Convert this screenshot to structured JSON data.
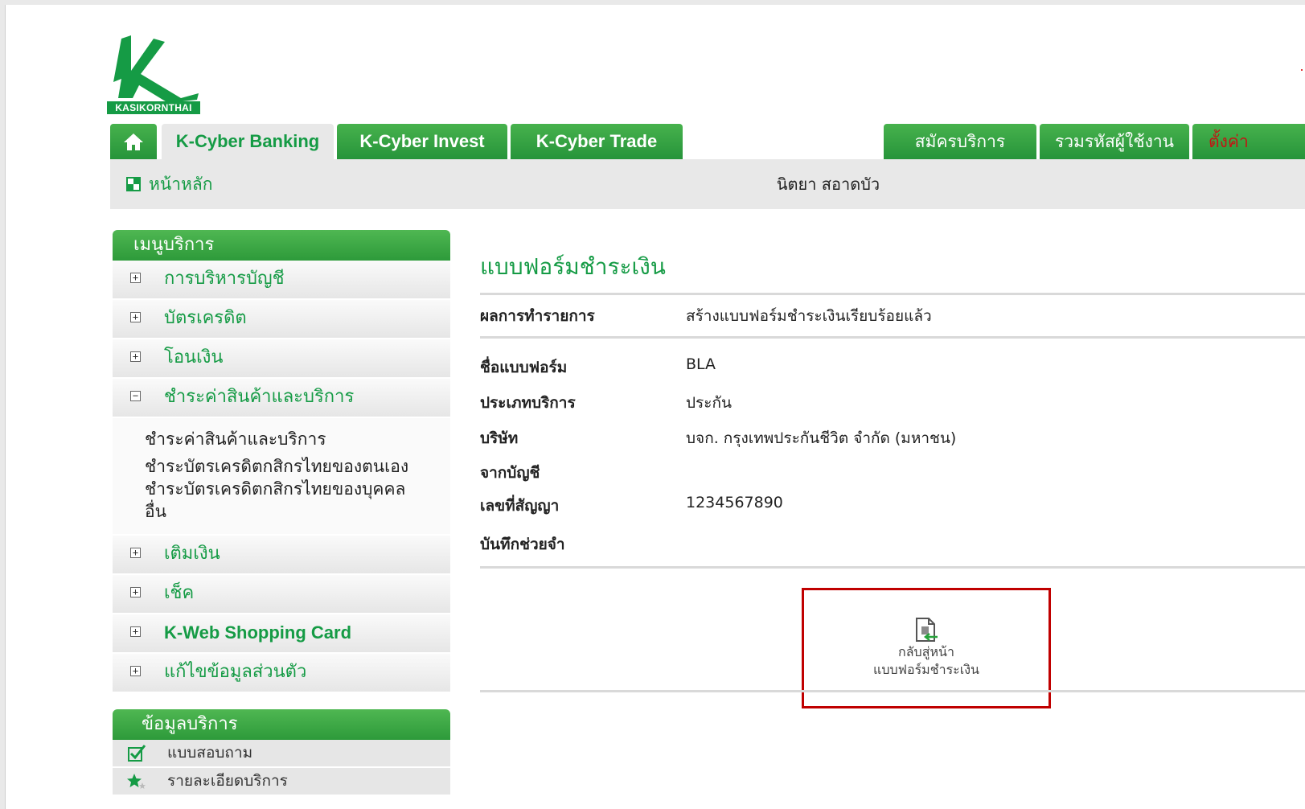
{
  "brand": {
    "logo_text": "KASIKORNTHAI"
  },
  "tabs": {
    "home": "home",
    "left": [
      "K-Cyber Banking",
      "K-Cyber Invest",
      "K-Cyber Trade"
    ],
    "right": [
      "สมัครบริการ",
      "รวมรหัสผู้ใช้งาน",
      "ตั้งค่า"
    ]
  },
  "topbar": {
    "home_label": "หน้าหลัก",
    "user_name": "นิตยา สอาดบัว"
  },
  "menu": {
    "title": "เมนูบริการ",
    "items_before": [
      "การบริหารบัญชี",
      "บัตรเครดิต",
      "โอนเงิน"
    ],
    "expanded": {
      "label": "ชำระค่าสินค้าและบริการ",
      "children": [
        "ชำระค่าสินค้าและบริการ",
        "ชำระบัตรเครดิตกสิกรไทยของตนเอง",
        "ชำระบัตรเครดิตกสิกรไทยของบุคคล",
        "อื่น"
      ]
    },
    "items_after": [
      "เติมเงิน",
      "เช็ค",
      "K-Web Shopping Card",
      "แก้ไขข้อมูลส่วนตัว"
    ]
  },
  "info": {
    "title": "ข้อมูลบริการ",
    "items": [
      "แบบสอบถาม",
      "รายละเอียดบริการ"
    ]
  },
  "content": {
    "title": "แบบฟอร์มชำระเงิน",
    "result_label": "ผลการทำรายการ",
    "result_value": "สร้างแบบฟอร์มชำระเงินเรียบร้อยแล้ว",
    "fields": [
      {
        "label": "ชื่อแบบฟอร์ม",
        "value": "BLA"
      },
      {
        "label": "ประเภทบริการ",
        "value": "ประกัน"
      },
      {
        "label": "บริษัท",
        "value": "บจก. กรุงเทพประกันชีวิต  จำกัด  (มหาชน)"
      },
      {
        "label": "จากบัญชี",
        "value": ""
      },
      {
        "label": "เลขที่สัญญา",
        "value": "1234567890"
      },
      {
        "label": "บันทึกช่วยจำ",
        "value": ""
      }
    ],
    "back_line1": "กลับสู่หน้า",
    "back_line2": "แบบฟอร์มชำระเงิน"
  },
  "colors": {
    "brand_green": "#159b45",
    "highlight_red": "#c00000"
  }
}
